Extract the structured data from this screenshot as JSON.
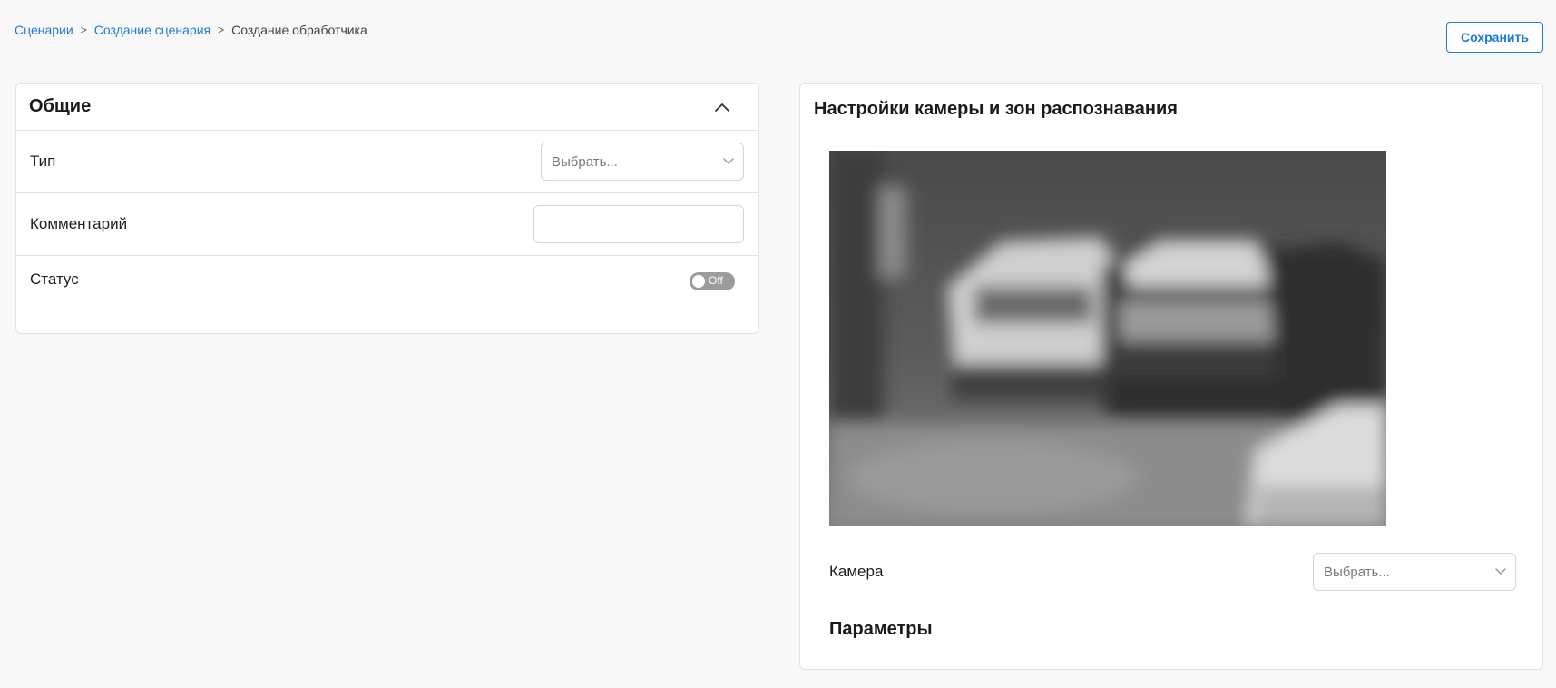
{
  "breadcrumb": {
    "items": [
      {
        "label": "Сценарии"
      },
      {
        "label": "Создание сценария"
      },
      {
        "label": "Создание обработчика"
      }
    ],
    "separator": ">"
  },
  "toolbar": {
    "save_label": "Сохранить"
  },
  "general": {
    "title": "Общие",
    "type_label": "Тип",
    "type_placeholder": "Выбрать...",
    "comment_label": "Комментарий",
    "comment_value": "",
    "status_label": "Статус",
    "status_toggle_text": "Off",
    "status_on": false
  },
  "camera_settings": {
    "title": "Настройки камеры и зон распознавания",
    "camera_label": "Камера",
    "camera_placeholder": "Выбрать...",
    "params_title": "Параметры"
  },
  "colors": {
    "accent": "#1f7ad6",
    "toggle_off": "#9b9b9b",
    "page_bg": "#f8f8f8"
  },
  "icons": {
    "collapse": "chevron-up-icon",
    "dropdown": "chevron-down-icon"
  }
}
